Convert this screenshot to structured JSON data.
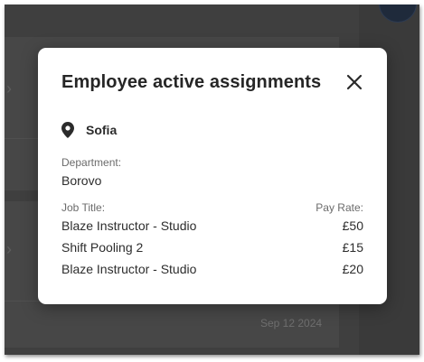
{
  "background": {
    "date_text": "Sep 12 2024"
  },
  "modal": {
    "title": "Employee active assignments",
    "close_icon": "close-icon",
    "location_icon": "map-pin-icon",
    "location": "Sofia",
    "department_label": "Department:",
    "department": "Borovo",
    "job_title_label": "Job Title:",
    "pay_rate_label": "Pay Rate:",
    "assignments": [
      {
        "title": "Blaze Instructor - Studio",
        "rate": "£50"
      },
      {
        "title": "Shift Pooling 2",
        "rate": "£15"
      },
      {
        "title": "Blaze Instructor - Studio",
        "rate": "£20"
      }
    ]
  },
  "colors": {
    "overlay": "#3f3f3f",
    "modal_bg": "#ffffff",
    "title_text": "#262626",
    "label_text": "#6b6b6b"
  }
}
